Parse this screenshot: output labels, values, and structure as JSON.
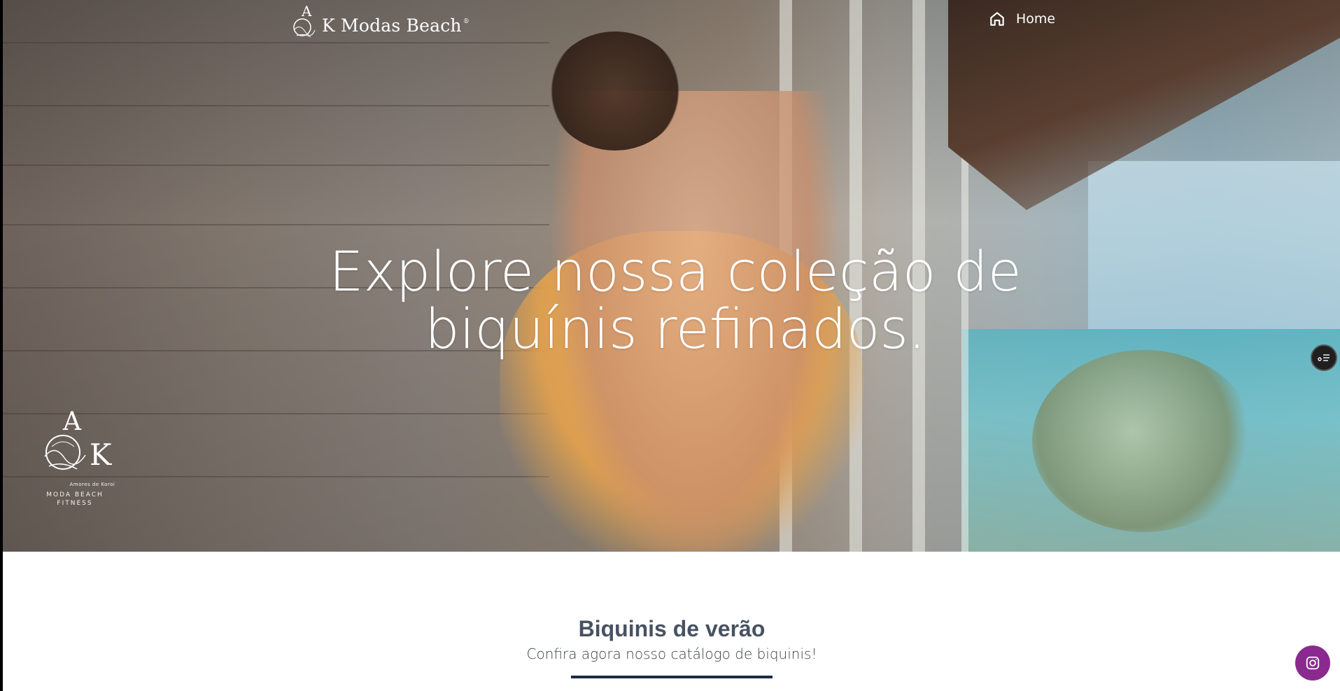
{
  "nav": {
    "brand": "K Modas Beach",
    "brand_reg": "®",
    "home_label": "Home"
  },
  "hero": {
    "title": "Explore nossa coleção de biquínis refinados.",
    "badge": {
      "tagline": "Amores de Koroi",
      "line1": "MODA BEACH",
      "line2": "FITNESS"
    }
  },
  "section": {
    "title": "Biquinis de verão",
    "subtitle": "Confira agora nosso catálogo de biquinis!"
  },
  "icons": {
    "home": "home-icon",
    "list": "list-icon",
    "instagram": "instagram-icon"
  },
  "colors": {
    "instagram_button": "#8a2a8f",
    "section_rule": "#1c2b47",
    "section_title": "#475262"
  }
}
